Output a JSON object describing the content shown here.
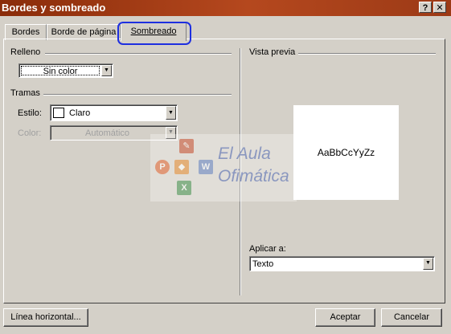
{
  "window": {
    "title": "Bordes y sombreado",
    "help_label": "?",
    "close_label": "✕"
  },
  "tabs": [
    {
      "label": "Bordes",
      "active": false
    },
    {
      "label": "Borde de página",
      "active": false
    },
    {
      "label": "Sombreado",
      "active": true
    }
  ],
  "relleno": {
    "header": "Relleno",
    "value": "Sin color"
  },
  "tramas": {
    "header": "Tramas",
    "estilo_label": "Estilo:",
    "estilo_value": "Claro",
    "color_label": "Color:",
    "color_value": "Automático"
  },
  "preview": {
    "header": "Vista previa",
    "sample_text": "AaBbCcYyZz",
    "apply_label": "Aplicar a:",
    "apply_value": "Texto"
  },
  "buttons": {
    "horizontal_line": "Línea horizontal...",
    "accept": "Aceptar",
    "cancel": "Cancelar"
  },
  "watermark": {
    "line1": "El Aula",
    "line2": "Ofimática"
  },
  "colors": {
    "title_bar": "#8a2c0a",
    "dialog_bg": "#d4d0c8",
    "highlight_ring": "#1e2fe0"
  }
}
